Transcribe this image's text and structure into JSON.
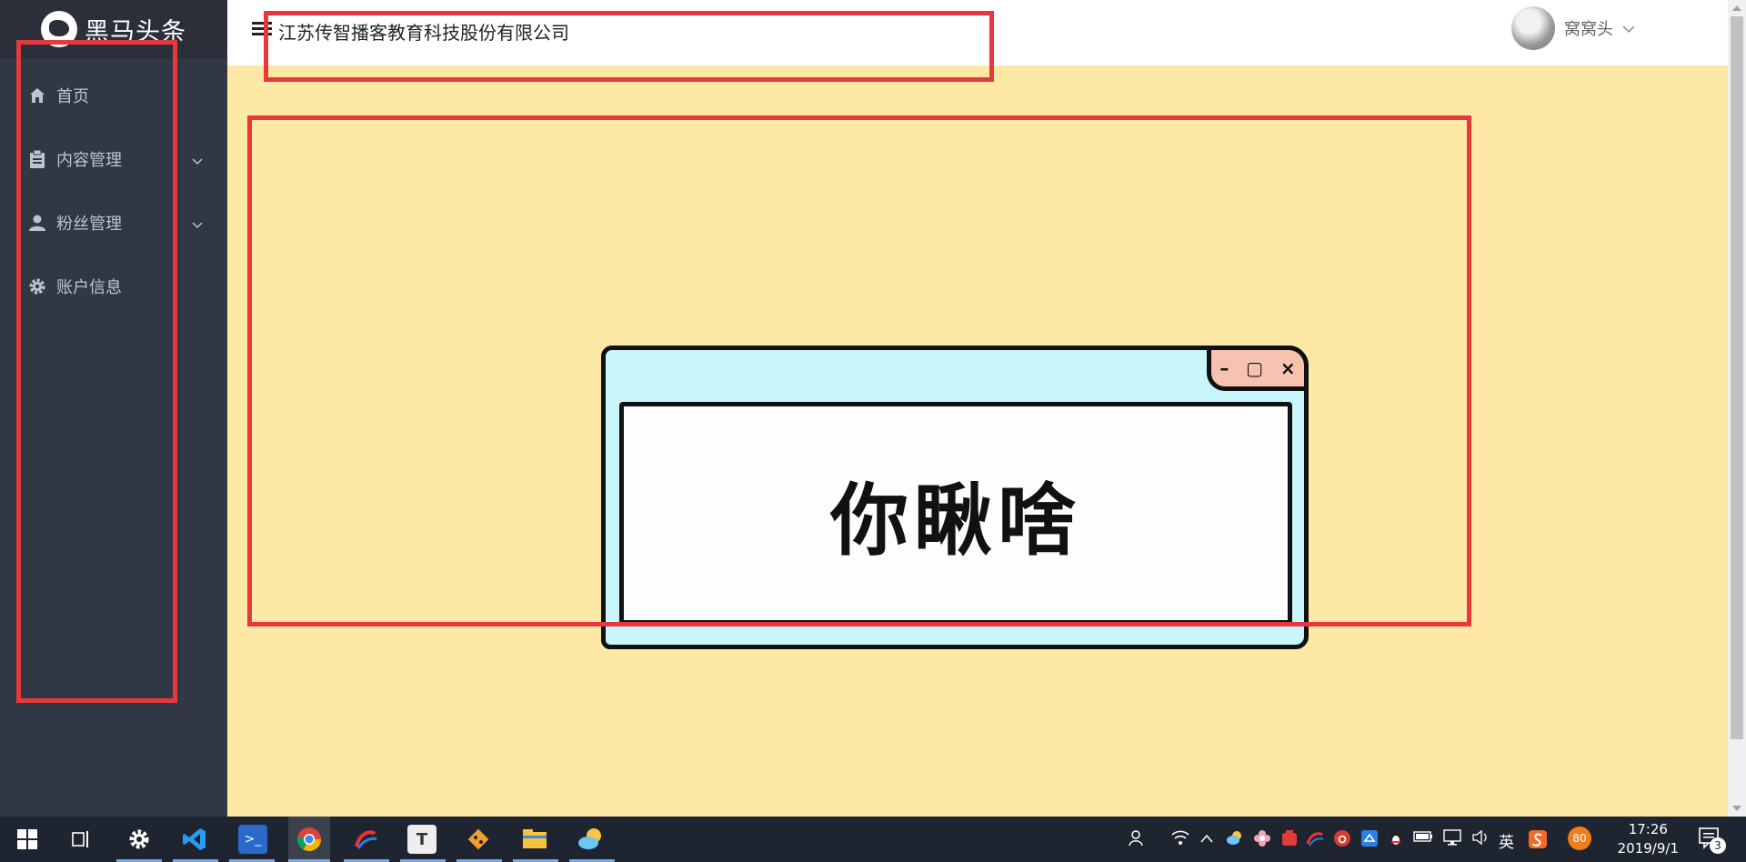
{
  "sidebar": {
    "logo_text": "黑马头条",
    "items": [
      {
        "label": "首页",
        "icon": "home-icon"
      },
      {
        "label": "内容管理",
        "icon": "clipboard-icon",
        "has_children": true
      },
      {
        "label": "粉丝管理",
        "icon": "user-icon",
        "has_children": true
      },
      {
        "label": "账户信息",
        "icon": "gear-icon"
      }
    ]
  },
  "header": {
    "company_name": "江苏传智播客教育科技股份有限公司",
    "username": "窝窝头"
  },
  "main": {
    "cartoon_text": "你瞅啥",
    "window_buttons": [
      "–",
      "▢",
      "×"
    ]
  },
  "taskbar": {
    "lang": "英",
    "badge": "80",
    "time": "17:26",
    "date": "2019/9/1",
    "notifications": "3"
  },
  "colors": {
    "sidebar_bg": "#323745",
    "content_bg": "#fde8a6",
    "annotation_red": "#e8383d"
  }
}
